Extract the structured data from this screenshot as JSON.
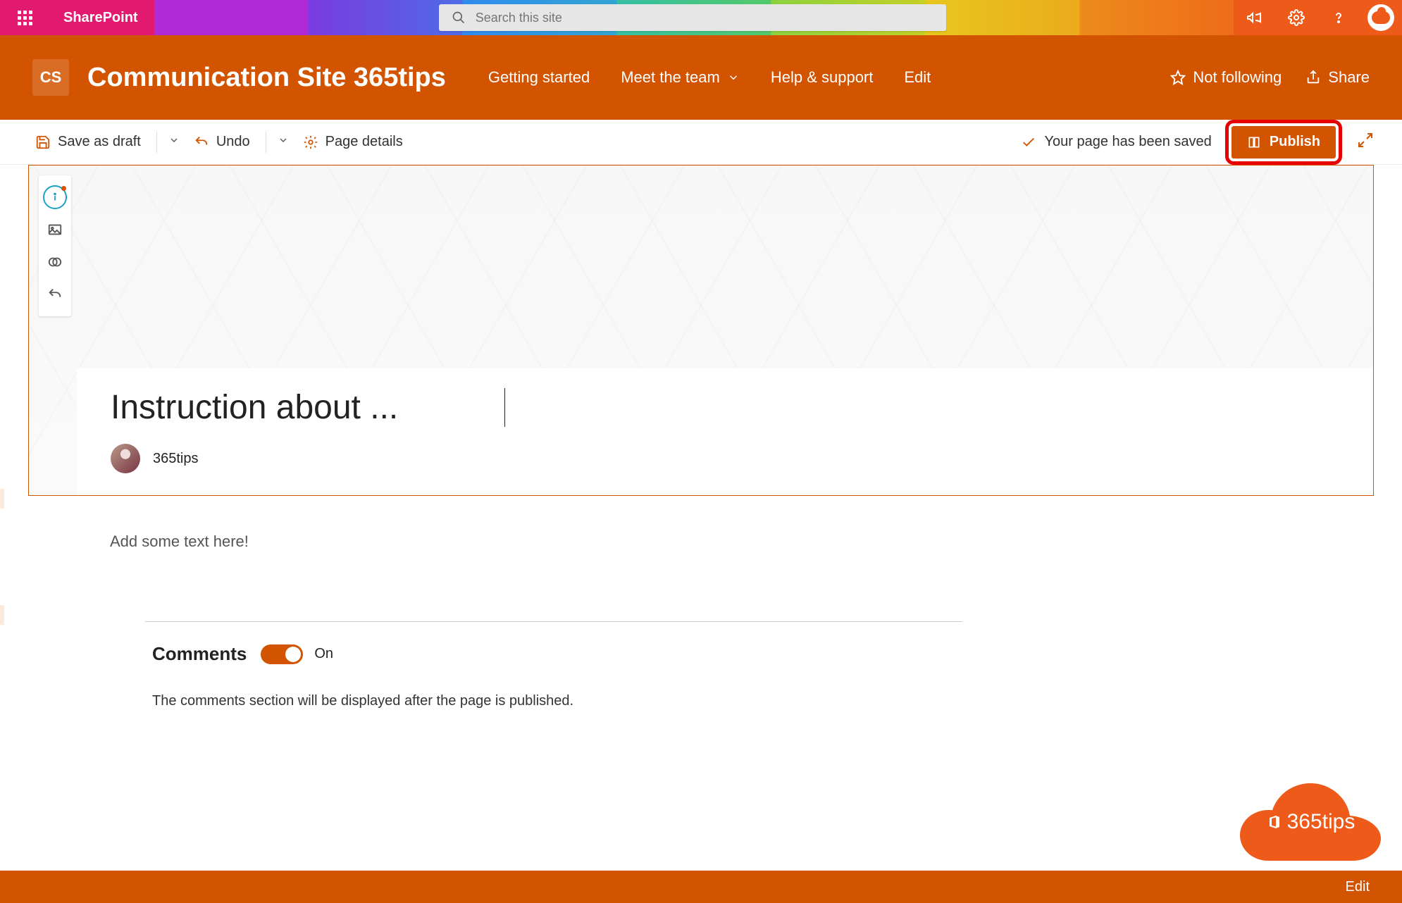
{
  "suite": {
    "app_name": "SharePoint",
    "search_placeholder": "Search this site"
  },
  "site": {
    "logo_initials": "CS",
    "title": "Communication Site 365tips",
    "nav": [
      {
        "label": "Getting started"
      },
      {
        "label": "Meet the team",
        "has_dropdown": true
      },
      {
        "label": "Help & support"
      },
      {
        "label": "Edit"
      }
    ],
    "actions": {
      "follow": "Not following",
      "share": "Share"
    }
  },
  "commands": {
    "save_draft": "Save as draft",
    "undo": "Undo",
    "page_details": "Page details",
    "status": "Your page has been saved",
    "publish": "Publish"
  },
  "page": {
    "title": "Instruction about ...",
    "author": "365tips",
    "body_placeholder": "Add some text here!"
  },
  "comments": {
    "heading": "Comments",
    "toggle_on": true,
    "toggle_label": "On",
    "note": "The comments section will be displayed after the page is published."
  },
  "footer": {
    "edit": "Edit",
    "cloud_logo_text": "365tips"
  }
}
